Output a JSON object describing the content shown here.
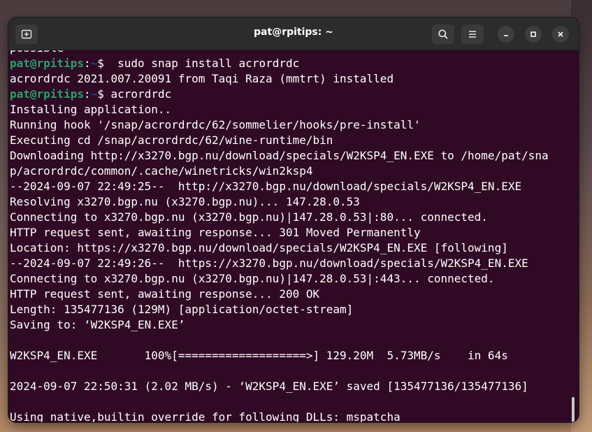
{
  "window": {
    "title": "pat@rpitips: ~"
  },
  "titlebar": {
    "new_tab_icon": "new-tab-icon",
    "search_icon": "search-icon",
    "menu_icon": "hamburger-menu-icon",
    "minimize_icon": "minimize-icon",
    "maximize_icon": "maximize-icon",
    "close_icon": "close-icon"
  },
  "terminal": {
    "colors": {
      "background": "#300a24",
      "text": "#ffffff",
      "user": "#26a269",
      "path": "#12488b"
    },
    "prompt": {
      "user": "pat@rpitips",
      "path": "~",
      "symbol": "$"
    },
    "lines": [
      {
        "type": "output",
        "text": "possible"
      },
      {
        "type": "prompt",
        "command": "  sudo snap install acrordrdc"
      },
      {
        "type": "output",
        "text": "acrordrdc 2021.007.20091 from Taqi Raza (mmtrt) installed"
      },
      {
        "type": "prompt",
        "command": " acrordrdc"
      },
      {
        "type": "output",
        "text": "Installing application.."
      },
      {
        "type": "output",
        "text": "Running hook '/snap/acrordrdc/62/sommelier/hooks/pre-install'"
      },
      {
        "type": "output",
        "text": "Executing cd /snap/acrordrdc/62/wine-runtime/bin"
      },
      {
        "type": "output",
        "text": "Downloading http://x3270.bgp.nu/download/specials/W2KSP4_EN.EXE to /home/pat/sna"
      },
      {
        "type": "output",
        "text": "p/acrordrdc/common/.cache/winetricks/win2ksp4"
      },
      {
        "type": "output",
        "text": "--2024-09-07 22:49:25--  http://x3270.bgp.nu/download/specials/W2KSP4_EN.EXE"
      },
      {
        "type": "output",
        "text": "Resolving x3270.bgp.nu (x3270.bgp.nu)... 147.28.0.53"
      },
      {
        "type": "output",
        "text": "Connecting to x3270.bgp.nu (x3270.bgp.nu)|147.28.0.53|:80... connected."
      },
      {
        "type": "output",
        "text": "HTTP request sent, awaiting response... 301 Moved Permanently"
      },
      {
        "type": "output",
        "text": "Location: https://x3270.bgp.nu/download/specials/W2KSP4_EN.EXE [following]"
      },
      {
        "type": "output",
        "text": "--2024-09-07 22:49:26--  https://x3270.bgp.nu/download/specials/W2KSP4_EN.EXE"
      },
      {
        "type": "output",
        "text": "Connecting to x3270.bgp.nu (x3270.bgp.nu)|147.28.0.53|:443... connected."
      },
      {
        "type": "output",
        "text": "HTTP request sent, awaiting response... 200 OK"
      },
      {
        "type": "output",
        "text": "Length: 135477136 (129M) [application/octet-stream]"
      },
      {
        "type": "output",
        "text": "Saving to: ‘W2KSP4_EN.EXE’"
      },
      {
        "type": "output",
        "text": ""
      },
      {
        "type": "output",
        "text": "W2KSP4_EN.EXE       100%[===================>] 129.20M  5.73MB/s    in 64s"
      },
      {
        "type": "output",
        "text": ""
      },
      {
        "type": "output",
        "text": "2024-09-07 22:50:31 (2.02 MB/s) - ‘W2KSP4_EN.EXE’ saved [135477136/135477136]"
      },
      {
        "type": "output",
        "text": ""
      },
      {
        "type": "output",
        "text": "Using native,builtin override for following DLLs: mspatcha"
      }
    ]
  }
}
